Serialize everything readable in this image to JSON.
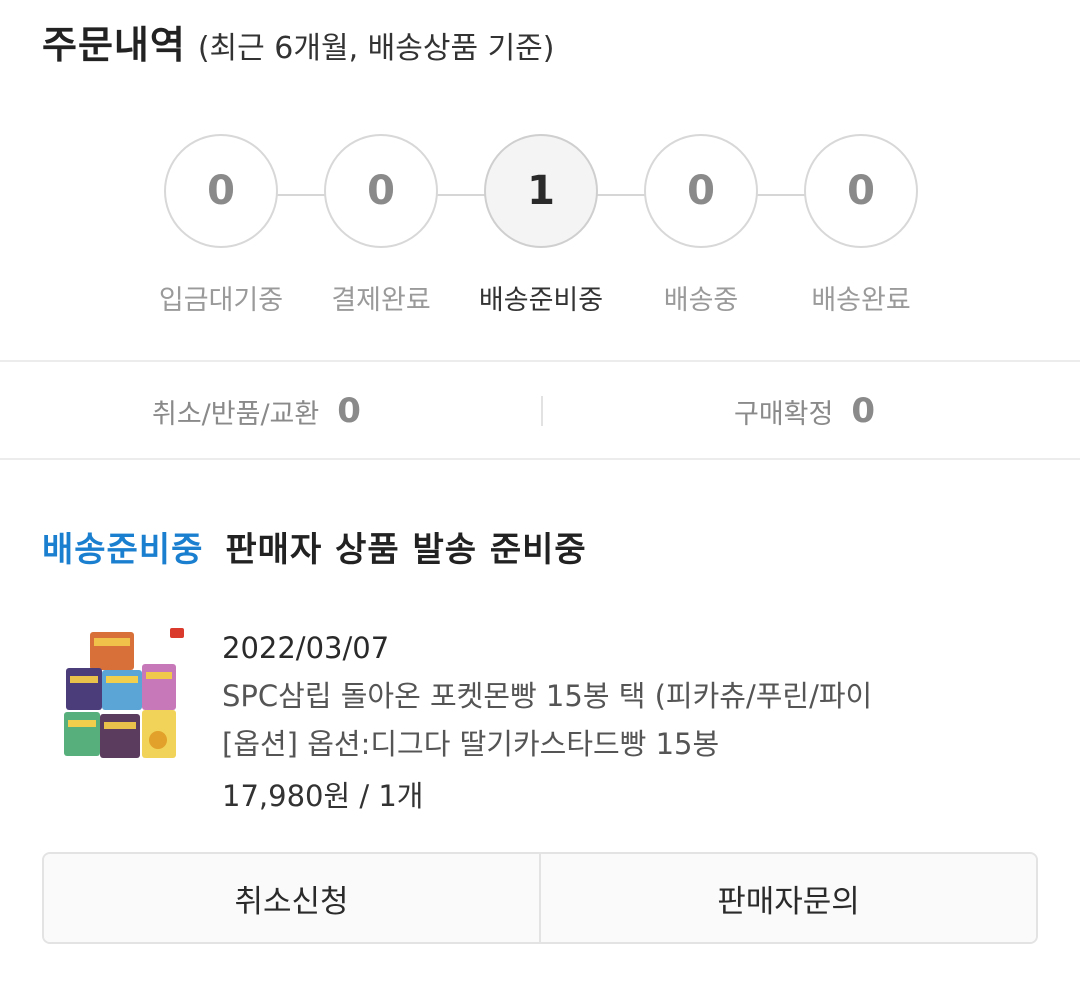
{
  "header": {
    "title": "주문내역",
    "subtitle": "(최근 6개월, 배송상품 기준)"
  },
  "steps": [
    {
      "count": "0",
      "label": "입금대기중",
      "active": false
    },
    {
      "count": "0",
      "label": "결제완료",
      "active": false
    },
    {
      "count": "1",
      "label": "배송준비중",
      "active": true
    },
    {
      "count": "0",
      "label": "배송중",
      "active": false
    },
    {
      "count": "0",
      "label": "배송완료",
      "active": false
    }
  ],
  "claims": {
    "cancel_return_exchange": {
      "label": "취소/반품/교환",
      "count": "0"
    },
    "purchase_confirm": {
      "label": "구매확정",
      "count": "0"
    }
  },
  "order": {
    "status_tag": "배송준비중",
    "status_desc": "판매자 상품 발송 준비중",
    "date": "2022/03/07",
    "product_name": "SPC삼립 돌아온 포켓몬빵 15봉 택 (피카츄/푸린/파이",
    "option": "[옵션] 옵션:디그다 딸기카스타드빵 15봉",
    "price_qty": "17,980원 / 1개"
  },
  "actions": {
    "cancel_label": "취소신청",
    "inquiry_label": "판매자문의"
  },
  "colors": {
    "accent": "#1b7fd0",
    "active_circle_bg": "#f4f4f4",
    "muted_text": "#9a9a9a"
  }
}
